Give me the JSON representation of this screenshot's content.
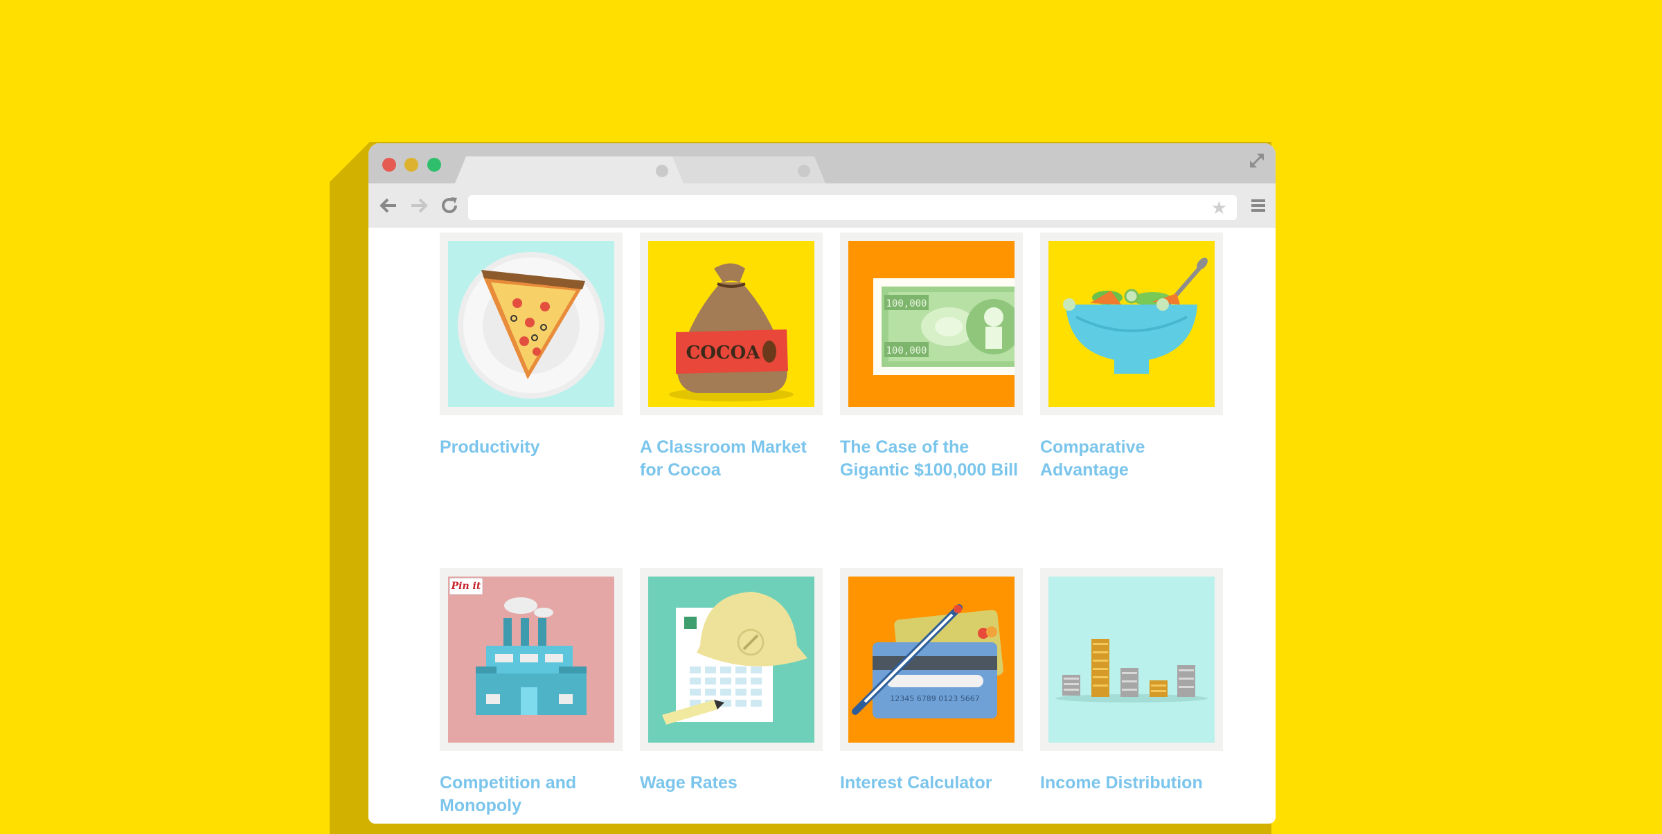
{
  "browser": {
    "tabs": [
      {
        "label": ""
      },
      {
        "label": ""
      }
    ],
    "url": "",
    "icons": {
      "back": "arrow-left-icon",
      "forward": "arrow-right-icon",
      "reload": "reload-icon",
      "bookmark": "star-icon",
      "menu": "hamburger-menu-icon",
      "expand": "expand-icon"
    },
    "colors": {
      "background": "#FFDF00",
      "link": "#7BC5EC"
    }
  },
  "cards": [
    {
      "title": "Productivity",
      "image": "pizza-slice-icon",
      "bg": "#BAF1EC"
    },
    {
      "title": "A Classroom Market for Cocoa",
      "image": "cocoa-sack-icon",
      "bg": "#FFDF00",
      "image_text": "COCOA"
    },
    {
      "title": "The Case of the Gigantic $100,000 Bill",
      "image": "banknote-icon",
      "bg": "#FF9300",
      "image_text": "100,000"
    },
    {
      "title": "Comparative Advantage",
      "image": "salad-bowl-icon",
      "bg": "#FFDF00"
    },
    {
      "title": "Competition and Monopoly",
      "image": "factory-icon",
      "bg": "#E5A6A6",
      "pin_label": "Pin it"
    },
    {
      "title": "Wage Rates",
      "image": "hard-hat-icon",
      "bg": "#6FD0B9"
    },
    {
      "title": "Interest Calculator",
      "image": "credit-card-icon",
      "bg": "#FF9300",
      "image_text": "12345 6789 0123 5667"
    },
    {
      "title": "Income Distribution",
      "image": "coin-stacks-icon",
      "bg": "#BAF1EC"
    }
  ]
}
